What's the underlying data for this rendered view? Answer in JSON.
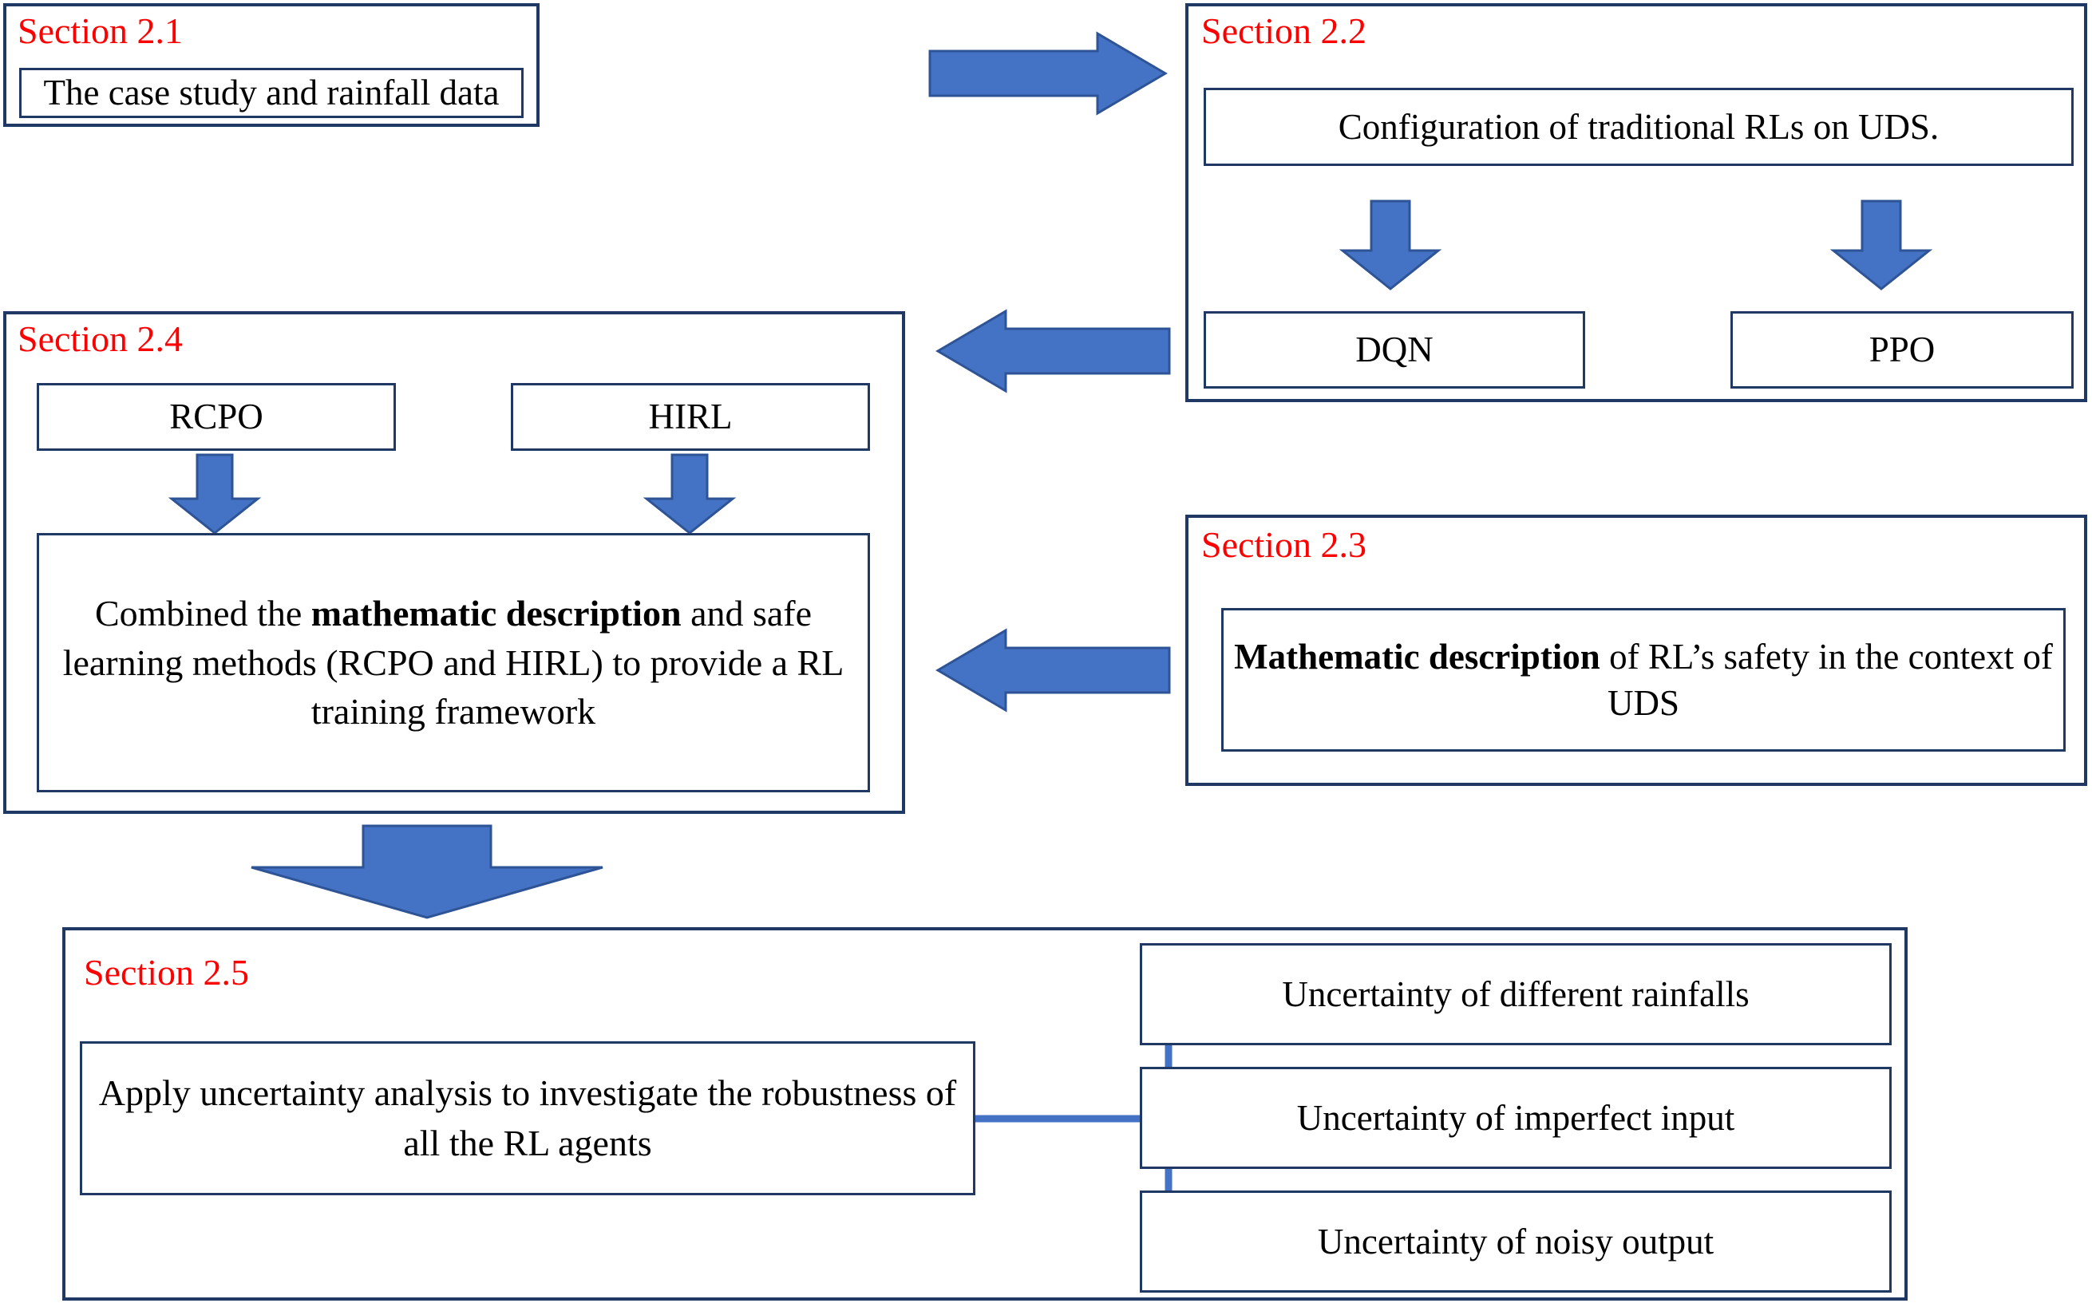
{
  "colors": {
    "arrow_fill": "#4472C4",
    "arrow_stroke": "#2E5496",
    "box_border": "#203864",
    "section_border": "#1F3864",
    "section_label": "#FF0000",
    "connector": "#4472C4",
    "text": "#000000",
    "background": "#FFFFFF"
  },
  "sections": {
    "s21": {
      "label": "Section 2.1",
      "box": {
        "text": "The case study and rainfall data"
      }
    },
    "s22": {
      "label": "Section 2.2",
      "config_box": {
        "text": "Configuration of traditional RLs on UDS."
      },
      "dqn_box": {
        "text": "DQN"
      },
      "ppo_box": {
        "text": "PPO"
      }
    },
    "s23": {
      "label": "Section 2.3",
      "box": {
        "bold": "Mathematic description",
        "rest": " of RL’s safety in the context of UDS",
        "full_text": "Mathematic description of RL’s safety in the context of UDS"
      }
    },
    "s24": {
      "label": "Section 2.4",
      "rcpo_box": {
        "text": "RCPO"
      },
      "hirl_box": {
        "text": "HIRL"
      },
      "combined_box": {
        "part1": "Combined the ",
        "bold1": "mathematic description",
        "part2": " and safe learning methods (RCPO and HIRL) to provide a RL training framework",
        "full_text": "Combined the mathematic description and safe learning methods (RCPO and HIRL) to provide a RL training framework"
      }
    },
    "s25": {
      "label": "Section 2.5",
      "apply_box": {
        "text": "Apply uncertainty analysis to investigate the robustness of all the RL agents"
      },
      "uncertainty_boxes": [
        {
          "text": "Uncertainty of different rainfalls"
        },
        {
          "text": "Uncertainty of imperfect input"
        },
        {
          "text": "Uncertainty of noisy output"
        }
      ]
    }
  },
  "arrows": {
    "s21_to_s22": {
      "direction": "right"
    },
    "s22_to_s24": {
      "direction": "left"
    },
    "s23_to_s24": {
      "direction": "left"
    },
    "config_to_dqn": {
      "direction": "down"
    },
    "config_to_ppo": {
      "direction": "down"
    },
    "rcpo_to_combined": {
      "direction": "down"
    },
    "hirl_to_combined": {
      "direction": "down"
    },
    "s24_to_s25": {
      "direction": "down"
    }
  }
}
